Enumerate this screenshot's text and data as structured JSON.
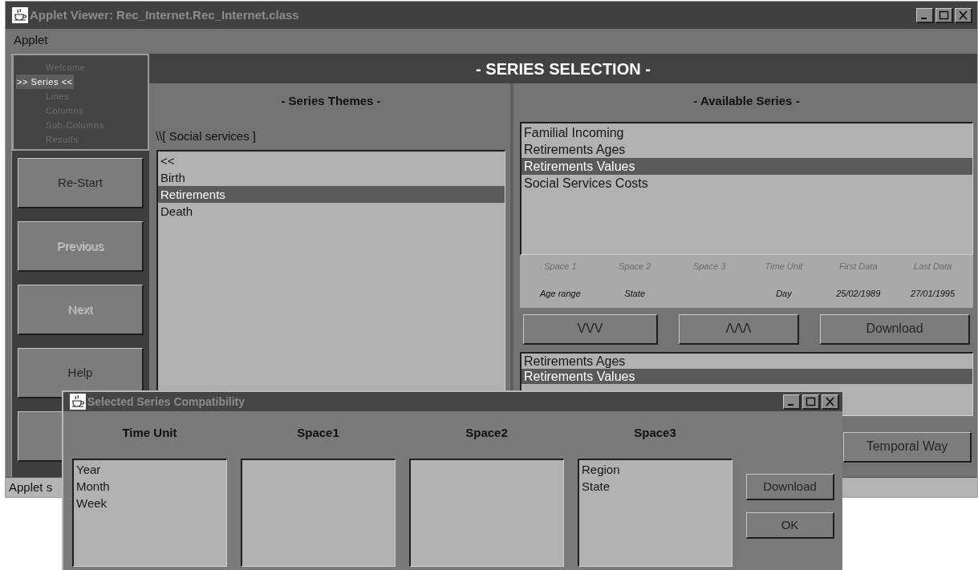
{
  "window": {
    "title": "Applet Viewer: Rec_Internet.Rec_Internet.class"
  },
  "menu": [
    "Applet"
  ],
  "nav": [
    {
      "label": "Welcome",
      "selected": false
    },
    {
      "label": ">> Series <<",
      "selected": true
    },
    {
      "label": "Lines",
      "selected": false
    },
    {
      "label": "Columns",
      "selected": false
    },
    {
      "label": "Sub-Columns",
      "selected": false
    },
    {
      "label": "Results",
      "selected": false
    }
  ],
  "side_buttons": [
    {
      "label": "Re-Start",
      "disabled": false
    },
    {
      "label": "Previous",
      "disabled": true
    },
    {
      "label": "Next",
      "disabled": true
    },
    {
      "label": "Help",
      "disabled": false
    }
  ],
  "header": "- SERIES SELECTION -",
  "themes": {
    "title": "- Series Themes -",
    "path": "\\\\[ Social services ]",
    "items": [
      {
        "label": "<<",
        "selected": false
      },
      {
        "label": "Birth",
        "selected": false
      },
      {
        "label": "Retirements",
        "selected": true
      },
      {
        "label": "Death",
        "selected": false
      }
    ]
  },
  "available": {
    "title": "- Available Series -",
    "items": [
      {
        "label": "Familial Incoming",
        "selected": false
      },
      {
        "label": "Retirements Ages",
        "selected": false
      },
      {
        "label": "Retirements Values",
        "selected": true
      },
      {
        "label": "Social Services Costs",
        "selected": false
      }
    ],
    "info": [
      {
        "label": "Space 1",
        "value": "Age range"
      },
      {
        "label": "Space 2",
        "value": "State"
      },
      {
        "label": "Space 3"
      },
      {
        "label": "Time Unit",
        "value": "Day"
      },
      {
        "label": "First Data",
        "value": "25/02/1989"
      },
      {
        "label": "Last Data",
        "value": "27/01/1995"
      }
    ],
    "buttons": [
      "VVV",
      "ΛΛΛ",
      "Download"
    ],
    "chosen": [
      {
        "label": "Retirements Ages",
        "selected": false
      },
      {
        "label": "Retirements Values",
        "selected": true
      }
    ],
    "temporal_button": "Temporal Way"
  },
  "status_bar": "Applet s",
  "dialog": {
    "title": "Selected Series Compatibility",
    "columns": [
      {
        "heading": "Time Unit",
        "items": [
          "Year",
          "Month",
          "Week"
        ]
      },
      {
        "heading": "Space1"
      },
      {
        "heading": "Space2"
      },
      {
        "heading": "Space3",
        "items": [
          "Region",
          "State"
        ]
      }
    ],
    "buttons": [
      "Download",
      "OK"
    ]
  }
}
